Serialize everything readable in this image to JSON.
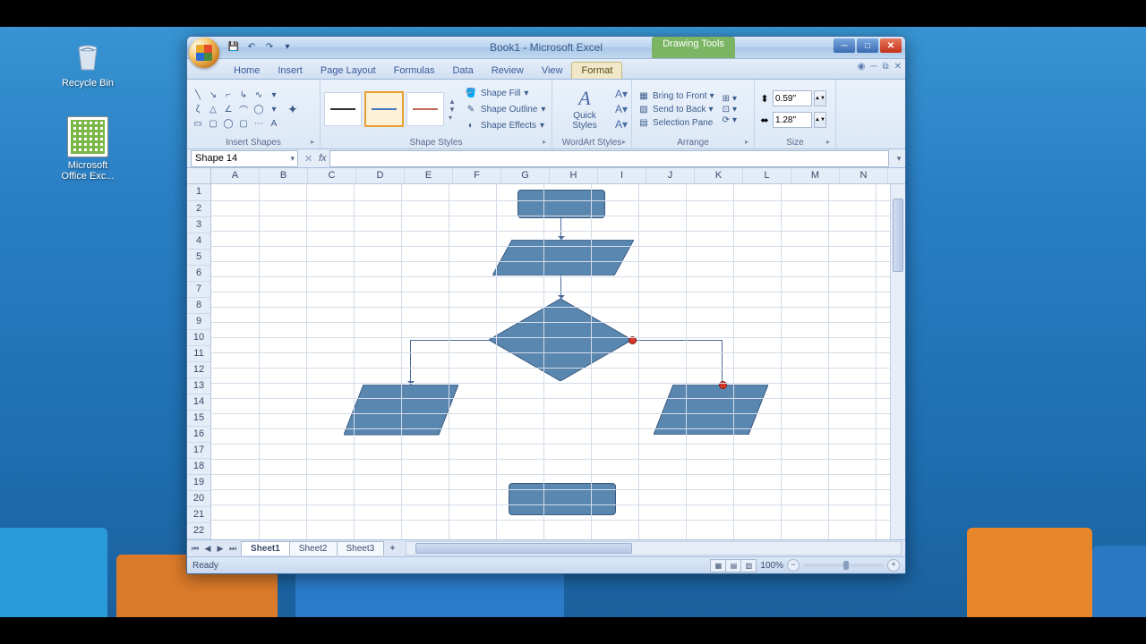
{
  "desktop": {
    "recycle_bin": "Recycle Bin",
    "excel_icon": "Microsoft Office Exc..."
  },
  "titlebar": {
    "title": "Book1 - Microsoft Excel",
    "context_tab": "Drawing Tools"
  },
  "tabs": {
    "home": "Home",
    "insert": "Insert",
    "page_layout": "Page Layout",
    "formulas": "Formulas",
    "data": "Data",
    "review": "Review",
    "view": "View",
    "format": "Format"
  },
  "ribbon": {
    "insert_shapes": "Insert Shapes",
    "shape_styles": "Shape Styles",
    "shape_fill": "Shape Fill",
    "shape_outline": "Shape Outline",
    "shape_effects": "Shape Effects",
    "wordart_styles": "WordArt Styles",
    "quick_styles": "Quick Styles",
    "arrange": "Arrange",
    "bring_front": "Bring to Front",
    "send_back": "Send to Back",
    "selection_pane": "Selection Pane",
    "size": "Size",
    "height": "0.59\"",
    "width": "1.28\""
  },
  "namebox": "Shape 14",
  "columns": [
    "A",
    "B",
    "C",
    "D",
    "E",
    "F",
    "G",
    "H",
    "I",
    "J",
    "K",
    "L",
    "M",
    "N"
  ],
  "rows": [
    "1",
    "2",
    "3",
    "4",
    "5",
    "6",
    "7",
    "8",
    "9",
    "10",
    "11",
    "12",
    "13",
    "14",
    "15",
    "16",
    "17",
    "18",
    "19",
    "20",
    "21",
    "22"
  ],
  "sheet_tabs": {
    "s1": "Sheet1",
    "s2": "Sheet2",
    "s3": "Sheet3"
  },
  "status": {
    "ready": "Ready",
    "zoom": "100%"
  }
}
